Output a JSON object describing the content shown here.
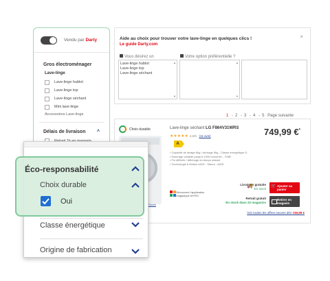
{
  "sidebar": {
    "vendu_par_prefix": "Vendu par",
    "vendu_par_brand": "Darty",
    "section_title": "Gros électroménager",
    "subsection": "Lave-linge",
    "items": [
      {
        "label": "Lave-linge hublot"
      },
      {
        "label": "Lave-linge top"
      },
      {
        "label": "Lave-linge séchant"
      },
      {
        "label": "Mini lave-linge"
      }
    ],
    "accessoires": "Accessoires Lave-linge",
    "livraison_title": "Délais de livraison",
    "retrait_partial": "Retrait 1h en magasin"
  },
  "guide": {
    "title": "Aide au choix pour trouver votre lave-linge en quelques clics !",
    "subtitle": "Le guide Darty.com",
    "close": "×",
    "col1_heading": "Vous désirez un",
    "col2_heading": "Votre option préférentielle ?",
    "options": [
      "Lave-linge hublot",
      "Lave-linge top",
      "Lave-linge séchant"
    ]
  },
  "pagination": {
    "pages": [
      "1",
      "2",
      "3",
      "4",
      "5"
    ],
    "current": "1",
    "next_label": "Page suivante"
  },
  "product": {
    "badge": "Choix durable",
    "title_prefix": "Lave-linge séchant",
    "title_model": "LG F864V31WRS",
    "price": "749,99 €",
    "price_sup": "*",
    "stars": "★★★★★",
    "rating_text": "4,6/5",
    "reviews_link": "(11 avis)",
    "energy_class": "A",
    "features": [
      "• Capacité de lavage 8kg / séchage 5kg - Classe énergétique D",
      "• Essorage variable jusqu'à 1400 tours/min - 72dB",
      "• Fin différée / Affichage du temps restant",
      "• Technologie 6 Motion AIDD - Steam - AIDD"
    ],
    "livraison_title": "Livraison gratuite",
    "livraison_status": "En stock",
    "cart_button": "Ajouter au panier",
    "retrait_title": "Retrait gratuit",
    "retrait_status": "En stock dans 22 magasins",
    "magasin_button": "Retirer en magasin",
    "marketplace_text": "Découvrez l'application magasique MYRO",
    "offers_link_prefix": "Voir toutes les offres neuves dès",
    "offers_link_price": "749,99 €",
    "partial_link": "Ouvrir"
  },
  "zoom": {
    "eco_title": "Éco-responsabilité",
    "choix_durable": "Choix durable",
    "oui": "Oui",
    "classe": "Classe énergétique",
    "origine": "Origine de fabrication"
  },
  "colors": {
    "brand_red": "#e30613",
    "accent_green": "#7fc99b",
    "caret_blue": "#1f3f8f",
    "checkbox_blue": "#1f6fd1"
  }
}
